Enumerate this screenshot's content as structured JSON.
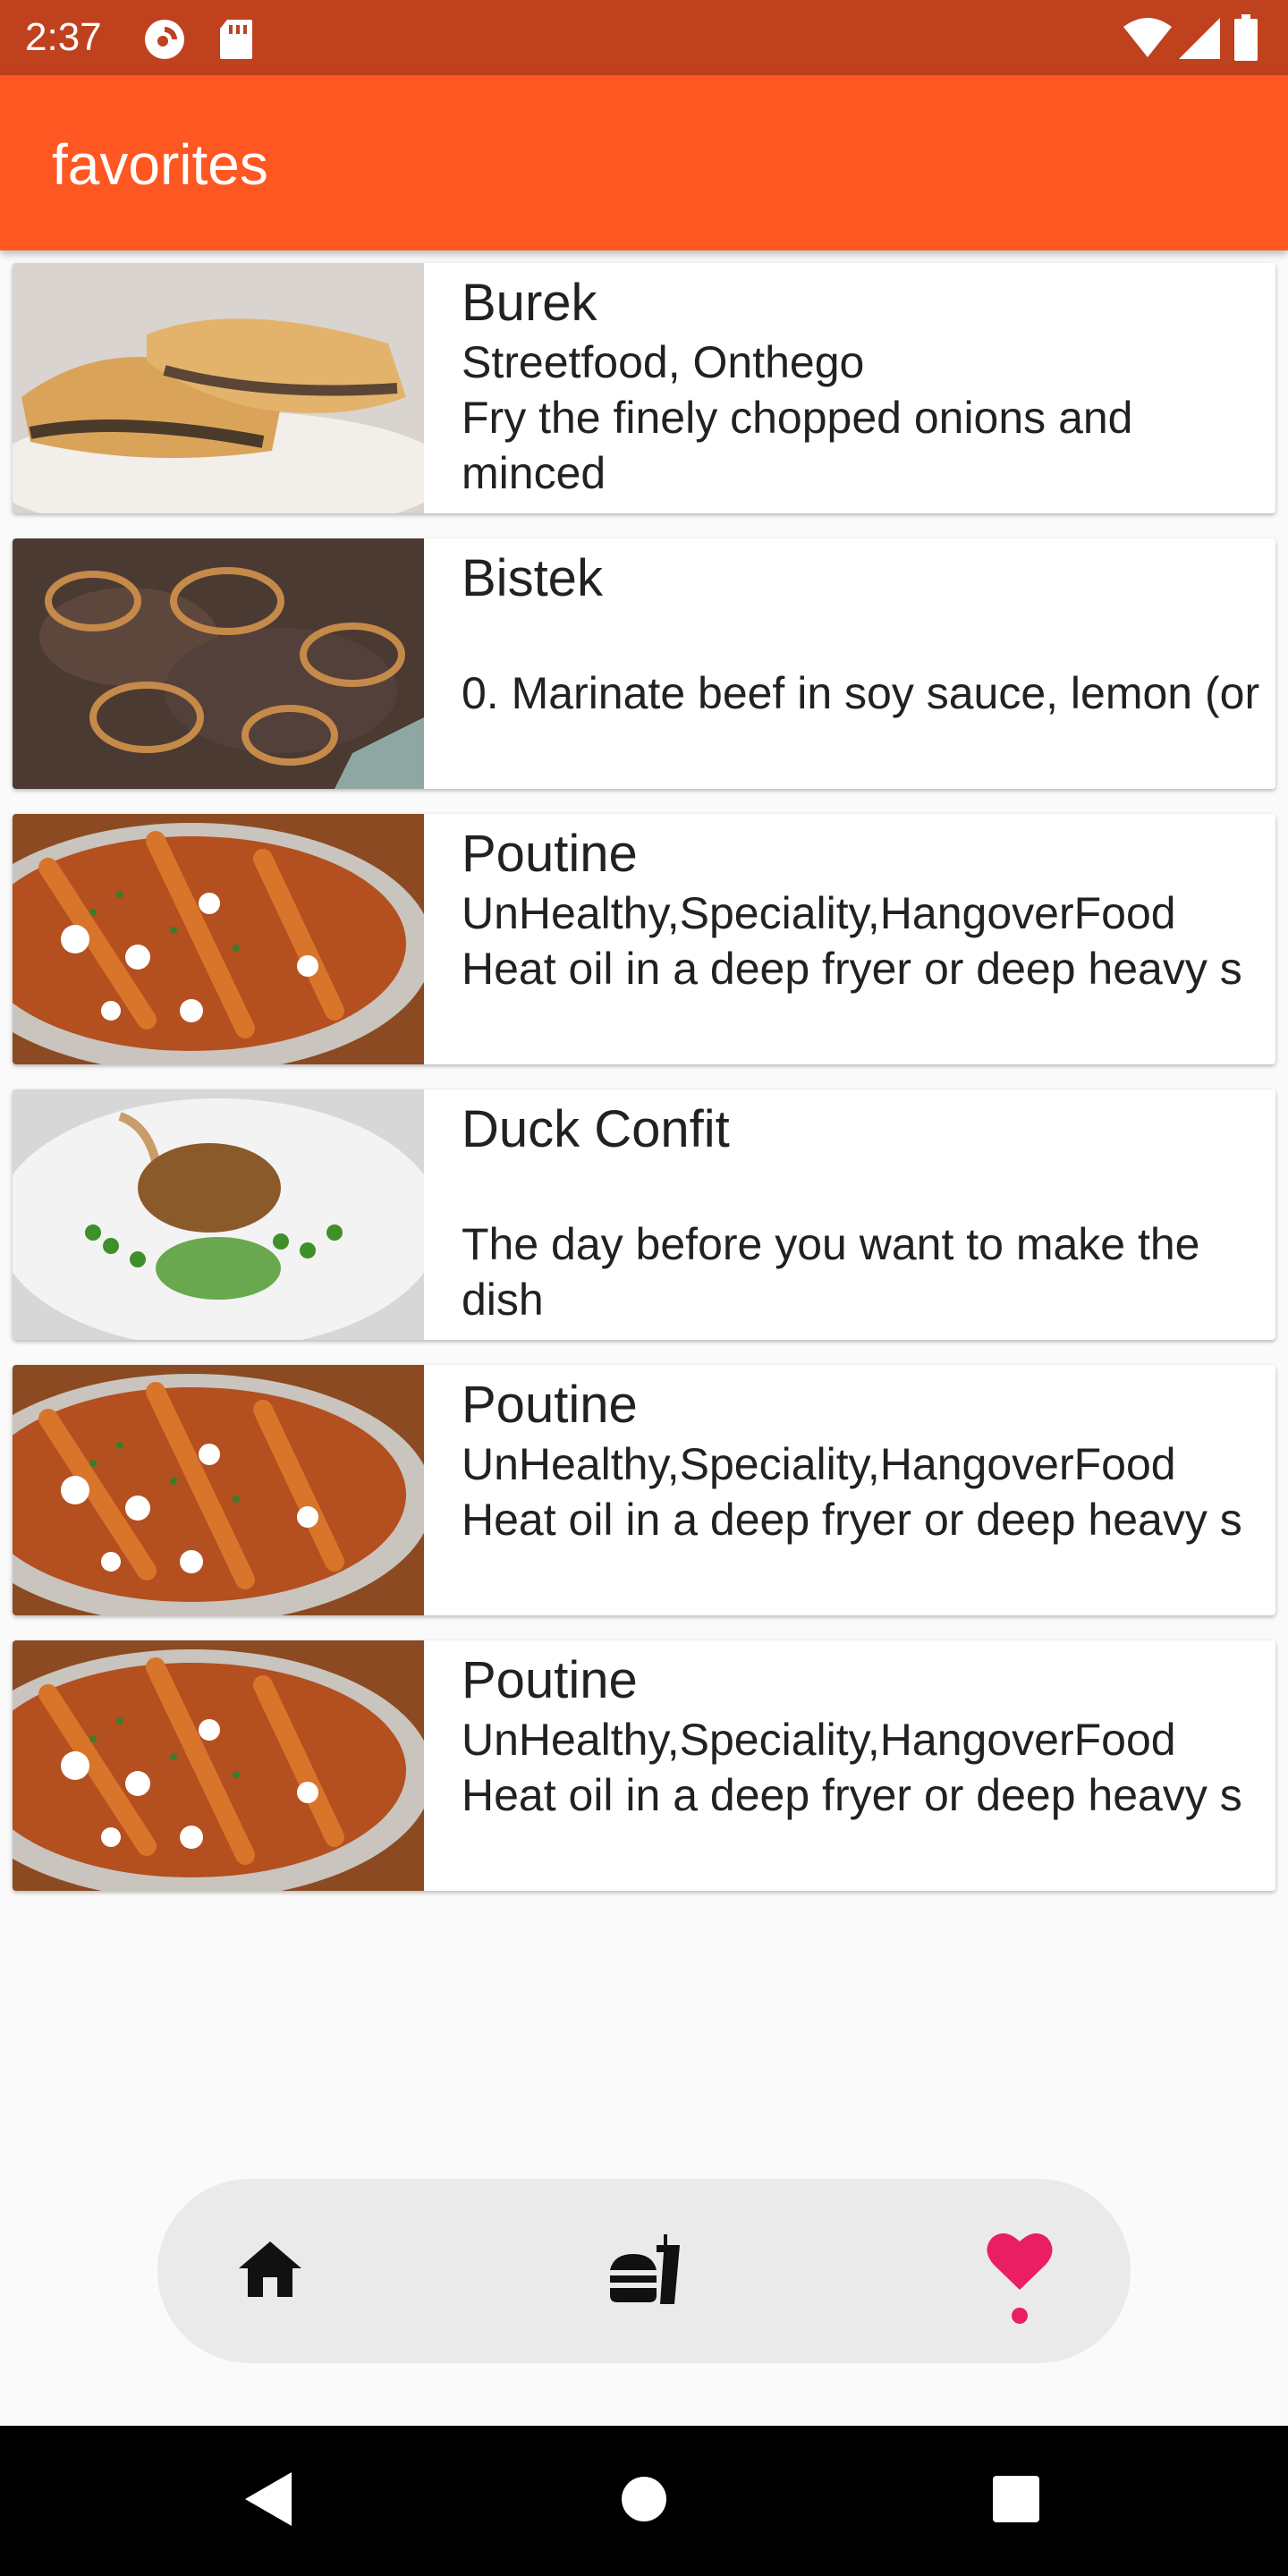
{
  "status_bar": {
    "time": "2:37",
    "icons": [
      "pocket-casts-icon",
      "sd-card-icon",
      "wifi-icon",
      "cellular-signal-icon",
      "battery-icon"
    ]
  },
  "app_bar": {
    "title": "favorites"
  },
  "favorites": [
    {
      "title": "Burek",
      "category": "Streetfood, Onthego",
      "description": "Fry the finely chopped onions and minced",
      "image": "burek-photo"
    },
    {
      "title": "Bistek",
      "category": "",
      "description": "0. Marinate beef in soy sauce, lemon (or",
      "image": "bistek-photo"
    },
    {
      "title": "Poutine",
      "category": "UnHealthy,Speciality,HangoverFood",
      "description": "Heat oil in a deep fryer or deep heavy s",
      "image": "poutine-photo"
    },
    {
      "title": "Duck Confit",
      "category": "",
      "description": "The day before you want to make the dish",
      "image": "duck-confit-photo"
    },
    {
      "title": "Poutine",
      "category": "UnHealthy,Speciality,HangoverFood",
      "description": "Heat oil in a deep fryer or deep heavy s",
      "image": "poutine-photo"
    },
    {
      "title": "Poutine",
      "category": "UnHealthy,Speciality,HangoverFood",
      "description": "Heat oil in a deep fryer or deep heavy s",
      "image": "poutine-photo"
    }
  ],
  "bottom_nav": {
    "items": [
      {
        "icon": "home-icon",
        "selected": false
      },
      {
        "icon": "fastfood-icon",
        "selected": false
      },
      {
        "icon": "heart-icon",
        "selected": true
      }
    ]
  },
  "system_nav": {
    "icons": [
      "back-icon",
      "home-circle-icon",
      "recents-icon"
    ]
  },
  "colors": {
    "status_bar": "#c0411e",
    "app_bar": "#ff5722",
    "accent": "#e91e63",
    "nav_background": "#ebeaea"
  }
}
